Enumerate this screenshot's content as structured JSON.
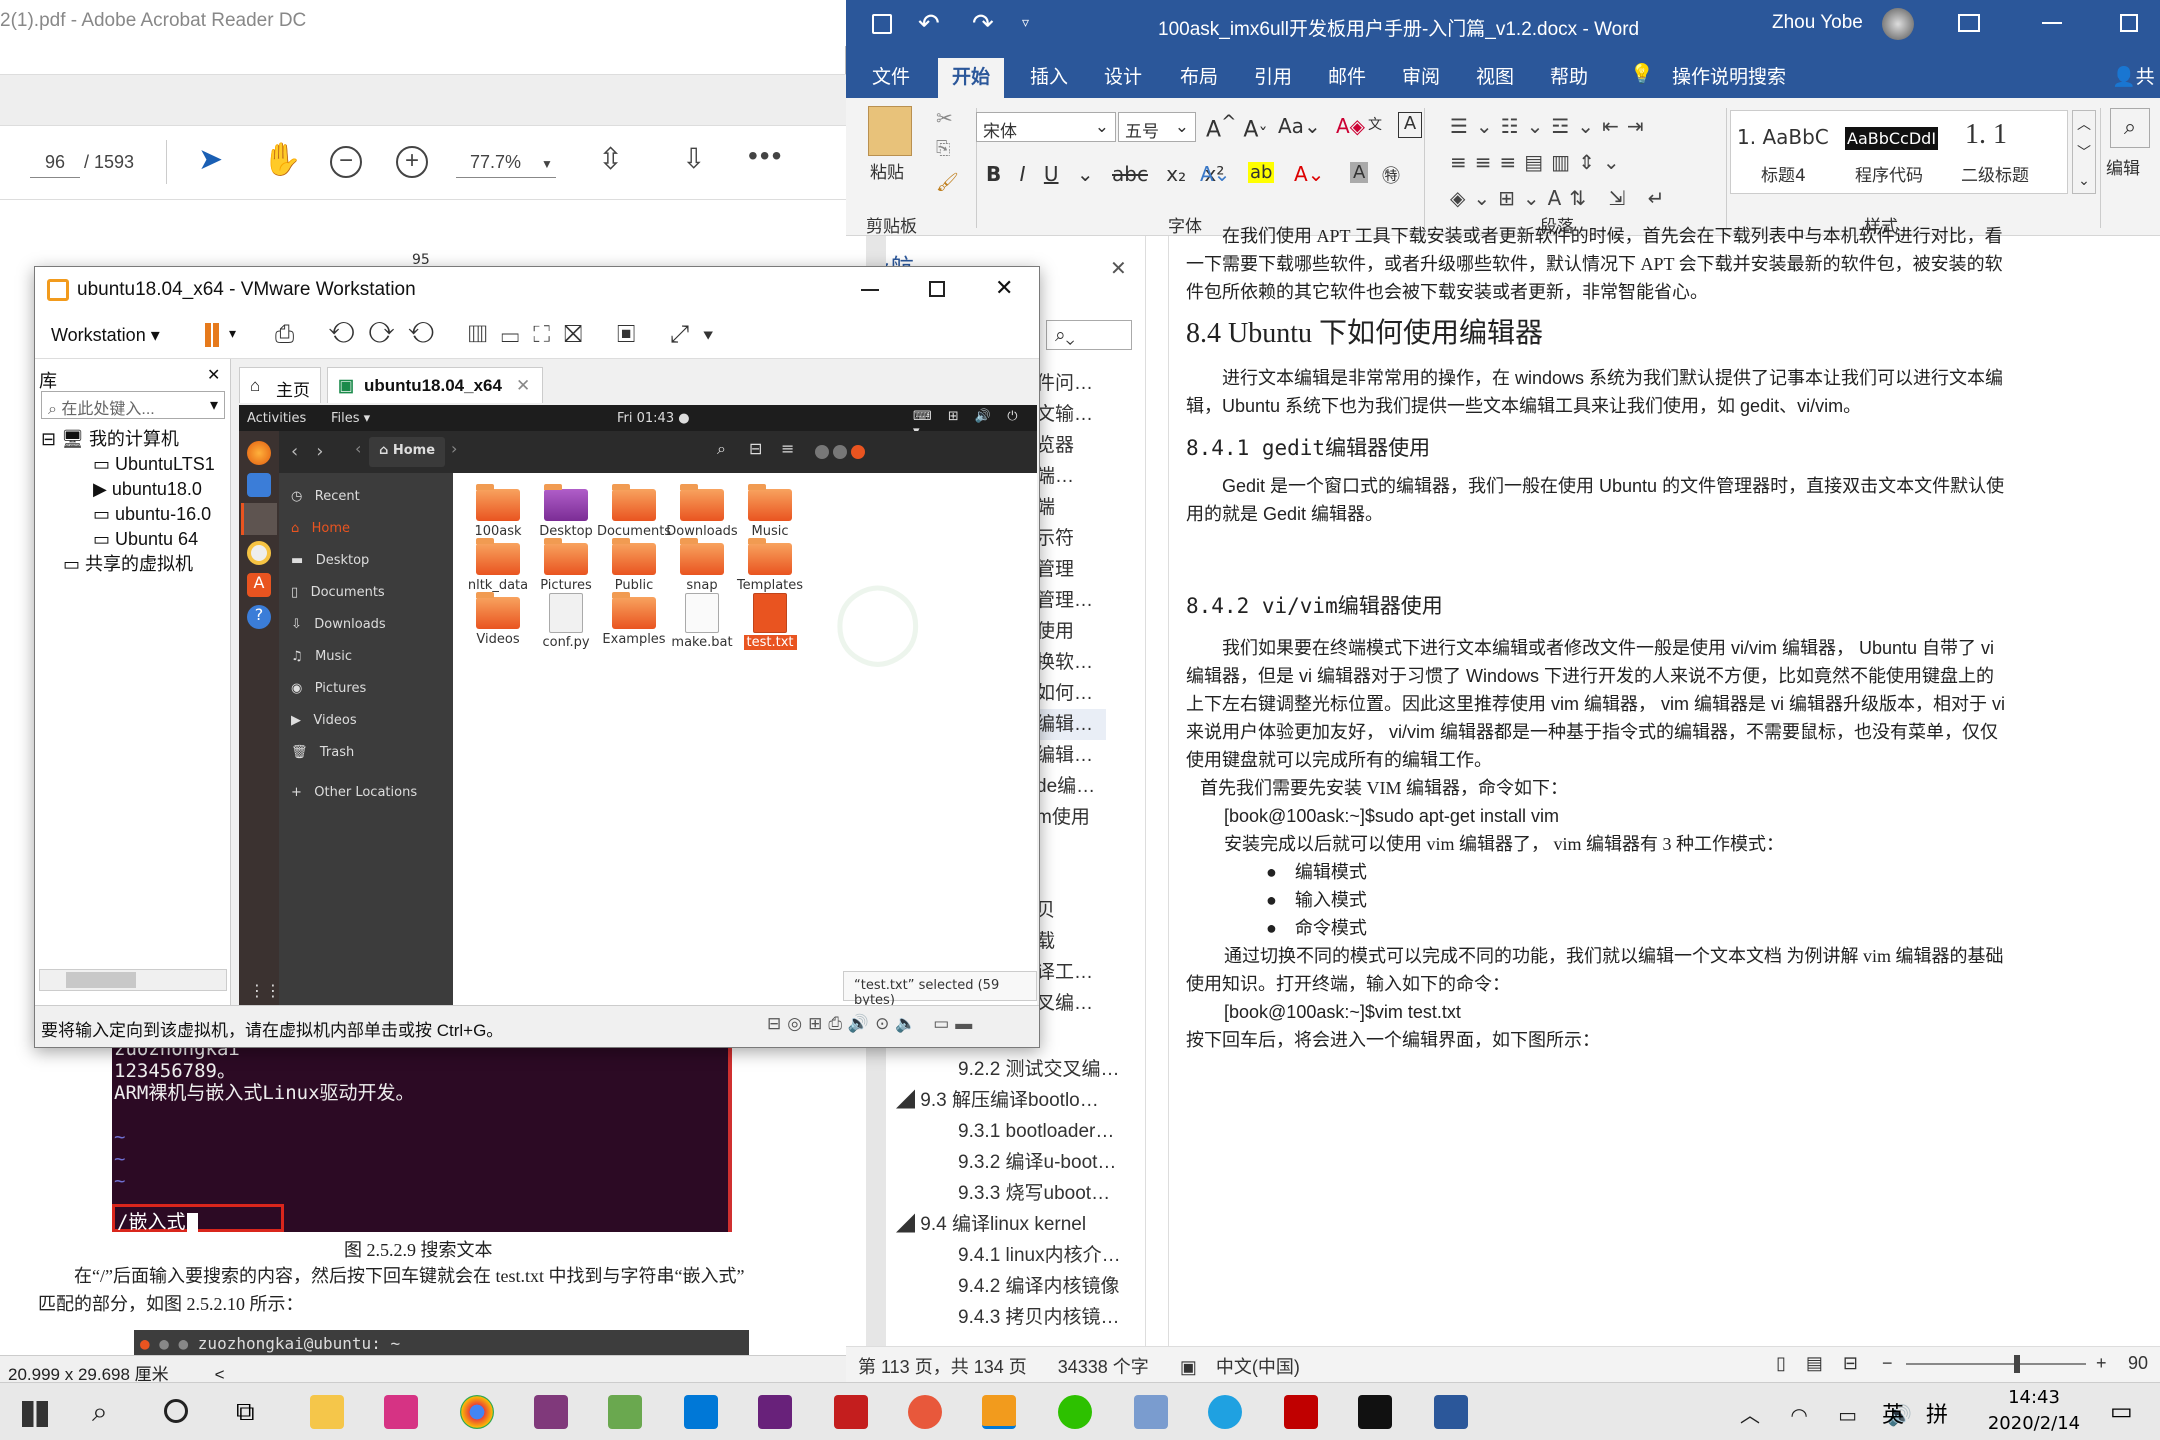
{
  "pdf": {
    "title": "2(1).pdf - Adobe Acrobat Reader DC",
    "page_current": "96",
    "page_total": "/ 1593",
    "zoom": "77.7%",
    "page_num_top": "95",
    "terminal_lines": [
      "zuozhongkai",
      "123456789。",
      "ARM裸机与嵌入式Linux驱动开发。",
      "",
      "~",
      "~",
      "~"
    ],
    "search_text": "/嵌入式",
    "figure_caption": "图 2.5.2.9 搜索文本",
    "para1": "在“/”后面输入要搜索的内容，然后按下回车键就会在 test.txt 中找到与字符串“嵌入式”",
    "para2": "匹配的部分，如图 2.5.2.10 所示：",
    "term2_title": "zuozhongkai@ubuntu: ~",
    "status_size": "20.999 x 29.698 厘米"
  },
  "word": {
    "title": "100ask_imx6ull开发板用户手册-入门篇_v1.2.docx  -  Word",
    "user": "Zhou Yobe",
    "tabs": [
      "文件",
      "开始",
      "插入",
      "设计",
      "布局",
      "引用",
      "邮件",
      "审阅",
      "视图",
      "帮助",
      "操作说明搜索"
    ],
    "share": "共",
    "ribbon": {
      "paste": "粘贴",
      "clipboard": "剪贴板",
      "font_name": "宋体",
      "font_size": "五号",
      "font_group": "字体",
      "para_group": "段落",
      "styles_group": "样式",
      "edit": "编辑",
      "styles": [
        {
          "preview": "1.  AaBbC",
          "name": "标题4"
        },
        {
          "preview": "AaBbCcDdI",
          "name": "程序代码"
        },
        {
          "preview": "1. 1",
          "name": "二级标题"
        }
      ]
    },
    "nav": {
      "title": "导航",
      "partial_items": [
        "件问…",
        "文输…",
        "览器",
        "端…",
        "端",
        "示符",
        "管理",
        "管理…",
        "使用",
        "换软…",
        "如何…",
        "编辑…",
        "编辑…",
        "de编…",
        "m使用",
        "贝",
        "载",
        "译工…",
        "叉编…"
      ],
      "items": [
        "9.2.2 测试交叉编…",
        "9.3 解压编译bootlo…",
        "9.3.1 bootloader…",
        "9.3.2 编译u-boot…",
        "9.3.3 烧写uboot…",
        "9.4 编译linux kernel",
        "9.4.1 linux内核介…",
        "9.4.2 编译内核镜像",
        "9.4.3 拷贝内核镜…"
      ]
    },
    "doc": {
      "p0": "在我们使用 APT 工具下载安装或者更新软件的时候，首先会在下载列表中与本机软件进行对比，看一下需要下载哪些软件，或者升级哪些软件，默认情况下 APT 会下载并安装最新的软件包，被安装的软件包所依赖的其它软件也会被下载安装或者更新，非常智能省心。",
      "h84": "8.4    Ubuntu 下如何使用编辑器",
      "p1": "进行文本编辑是非常常用的操作，在 windows 系统为我们默认提供了记事本让我们可以进行文本编辑，Ubuntu 系统下也为我们提供一些文本编辑工具来让我们使用，如 gedit、vi/vim。",
      "h841": "8.4.1   gedit编辑器使用",
      "p2": "Gedit 是一个窗口式的编辑器，我们一般在使用 Ubuntu 的文件管理器时，直接双击文本文件默认使用的就是 Gedit 编辑器。",
      "h842": "8.4.2   vi/vim编辑器使用",
      "p3": "我们如果要在终端模式下进行文本编辑或者修改文件一般是使用 vi/vim 编辑器， Ubuntu 自带了 vi 编辑器，但是 vi 编辑器对于习惯了 Windows 下进行开发的人来说不方便，比如竟然不能使用键盘上的上下左右键调整光标位置。因此这里推荐使用 vim 编辑器， vim 编辑器是 vi 编辑器升级版本，相对于 vi 来说用户体验更加友好， vi/vim 编辑器都是一种基于指令式的编辑器，不需要鼠标，也没有菜单，仅仅使用键盘就可以完成所有的编辑工作。",
      "p4": "首先我们需要先安装 VIM 编辑器，命令如下：",
      "cmd1": "[book@100ask:~]$sudo apt-get install vim",
      "p5": "安装完成以后就可以使用 vim 编辑器了， vim 编辑器有 3 种工作模式：",
      "bullets": [
        "编辑模式",
        "输入模式",
        "命令模式"
      ],
      "p6": "通过切换不同的模式可以完成不同的功能，我们就以编辑一个文本文档 为例讲解 vim 编辑器的基础使用知识。打开终端，输入如下的命令：",
      "cmd2": "[book@100ask:~]$vim test.txt",
      "p7": "按下回车后，将会进入一个编辑界面，如下图所示："
    },
    "status": {
      "page": "第 113 页，共 134 页",
      "words": "34338 个字",
      "lang": "中文(中国)",
      "zoom": "90"
    }
  },
  "vmware": {
    "title": "ubuntu18.04_x64 - VMware Workstation",
    "menu": "Workstation",
    "library_title": "库",
    "search_placeholder": "在此处键入...",
    "tree": [
      "我的计算机",
      "UbuntuLTS1",
      "ubuntu18.0",
      "ubuntu-16.0",
      "Ubuntu 64",
      "共享的虚拟机"
    ],
    "tab_home": "主页",
    "tab_vm": "ubuntu18.04_x64",
    "status": "要将输入定向到该虚拟机，请在虚拟机内部单击或按 Ctrl+G。",
    "guest": {
      "activities": "Activities",
      "files_menu": "Files ▾",
      "clock": "Fri 01:43 ●",
      "path": "Home",
      "sidebar": [
        "Recent",
        "Home",
        "Desktop",
        "Documents",
        "Downloads",
        "Music",
        "Pictures",
        "Videos",
        "Trash",
        "Other Locations"
      ],
      "files": [
        "100ask",
        "Desktop",
        "Documents",
        "Downloads",
        "Music",
        "nltk_data",
        "Pictures",
        "Public",
        "snap",
        "Templates",
        "Videos",
        "conf.py",
        "Examples",
        "make.bat",
        "test.txt"
      ],
      "selection_status": "“test.txt” selected (59 bytes)"
    }
  },
  "taskbar": {
    "time": "14:43",
    "date": "2020/2/14",
    "ime": "英",
    "ime2": "拼"
  }
}
